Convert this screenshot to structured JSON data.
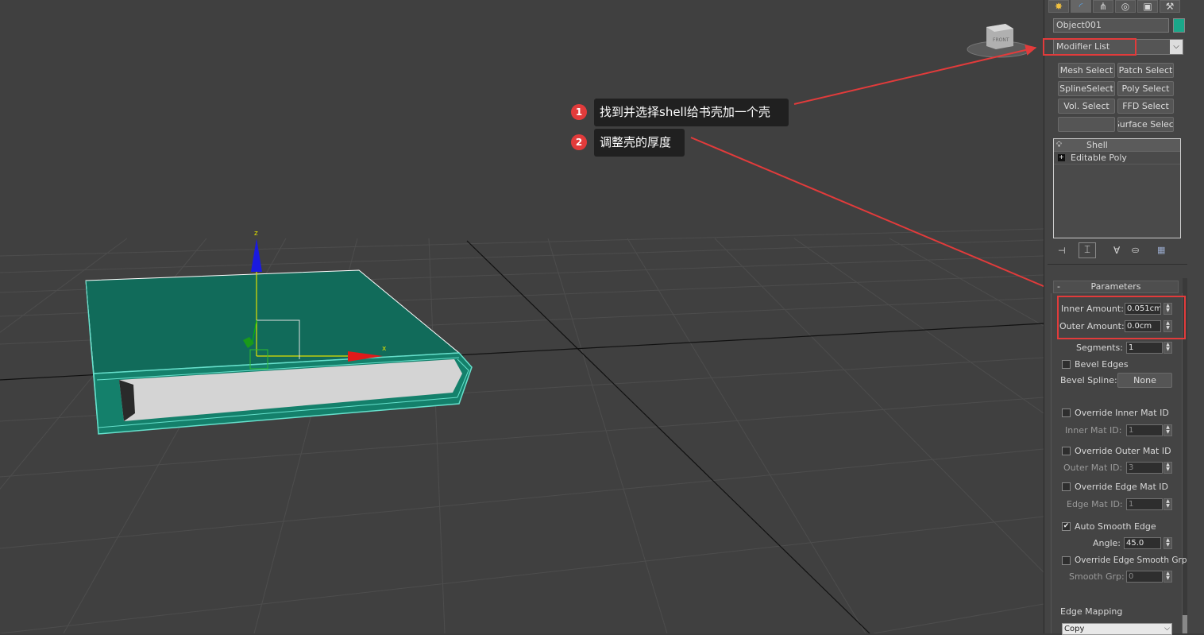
{
  "toolbar": {
    "tabs": [
      {
        "icon": "create-icon",
        "glyph": "✸",
        "color": "#f0c040"
      },
      {
        "icon": "modify-icon",
        "glyph": "◜",
        "color": "#5aa0e0"
      },
      {
        "icon": "hierarchy-icon",
        "glyph": "⋔",
        "color": "#dddddd"
      },
      {
        "icon": "motion-icon",
        "glyph": "◎",
        "color": "#dddddd"
      },
      {
        "icon": "display-icon",
        "glyph": "▣",
        "color": "#dddddd"
      },
      {
        "icon": "utilities-icon",
        "glyph": "⚒",
        "color": "#dddddd"
      }
    ]
  },
  "object": {
    "name": "Object001",
    "color": "#1aa88a"
  },
  "modifier_list": {
    "label": "Modifier List"
  },
  "quick_buttons": [
    "Mesh Select",
    "Patch Select",
    "SplineSelect",
    "Poly Select",
    "Vol. Select",
    "FFD Select",
    "",
    "Surface Select"
  ],
  "stack": {
    "items": [
      "Shell",
      "Editable Poly"
    ]
  },
  "rollout": {
    "title": "Parameters",
    "collapse": "-"
  },
  "params": {
    "inner_amount_label": "Inner Amount:",
    "inner_amount": "0.051cm",
    "outer_amount_label": "Outer Amount:",
    "outer_amount": "0.0cm",
    "segments_label": "Segments:",
    "segments": "1",
    "bevel_edges": "Bevel Edges",
    "bevel_spline_label": "Bevel Spline:",
    "bevel_spline": "None",
    "override_inner": "Override Inner Mat ID",
    "inner_mat_label": "Inner Mat ID:",
    "inner_mat": "1",
    "override_outer": "Override Outer Mat ID",
    "outer_mat_label": "Outer Mat ID:",
    "outer_mat": "3",
    "override_edge": "Override Edge Mat ID",
    "edge_mat_label": "Edge Mat ID:",
    "edge_mat": "1",
    "auto_smooth": "Auto Smooth Edge",
    "auto_smooth_checked": true,
    "angle_label": "Angle:",
    "angle": "45.0",
    "override_smooth": "Override Edge Smooth Grp",
    "smooth_grp_label": "Smooth Grp:",
    "smooth_grp": "0",
    "edge_mapping_label": "Edge Mapping",
    "edge_mapping": "Copy"
  },
  "viewport": {
    "gizmo_labels": {
      "z": "z",
      "x": "x"
    },
    "viewcube_label": "FRONT",
    "book_color": "#116b5a",
    "wire_color": "#66e0cc",
    "page_color": "#d4d4d4"
  },
  "annotations": [
    {
      "num": "1",
      "text": "找到并选择shell给书壳加一个壳"
    },
    {
      "num": "2",
      "text": "调整壳的厚度"
    }
  ],
  "accent": {
    "annotation": "#e23b3b"
  }
}
